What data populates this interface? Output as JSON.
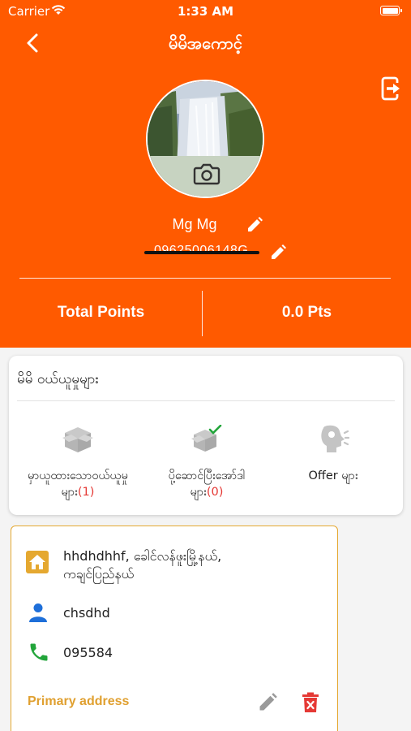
{
  "status_bar": {
    "carrier": "Carrier",
    "time": "1:33 AM"
  },
  "nav": {
    "title": "မိမိအကောင့်"
  },
  "profile": {
    "name": "Mg Mg",
    "phone": "09625006148G"
  },
  "points": {
    "label": "Total Points",
    "value": "0.0 Pts"
  },
  "orders": {
    "title": "မိမိ ဝယ်ယူမှုများ",
    "items": [
      {
        "label": "မှာယူထားသောဝယ်ယူမှု",
        "label2": "များ",
        "count": "(1)",
        "icon": "package-icon"
      },
      {
        "label": "ပို့ဆောင်ပြီးအော်ဒါ",
        "label2": "များ",
        "count": "(0)",
        "icon": "package-check-icon"
      },
      {
        "label": "Offer များ",
        "icon": "offer-speaker-icon"
      }
    ]
  },
  "address": {
    "line1": "hhdhdhhf, ခေါင်လန်ဖူးမြို့နယ်,",
    "line2": "ကချင်ပြည်နယ်",
    "name": "chsdhd",
    "phone": "095584",
    "primary_label": "Primary address"
  },
  "colors": {
    "brand": "#ff5a00",
    "accent_gold": "#e0a030",
    "danger": "#e53935",
    "person_blue": "#1e6fd9",
    "phone_green": "#22a53a"
  }
}
